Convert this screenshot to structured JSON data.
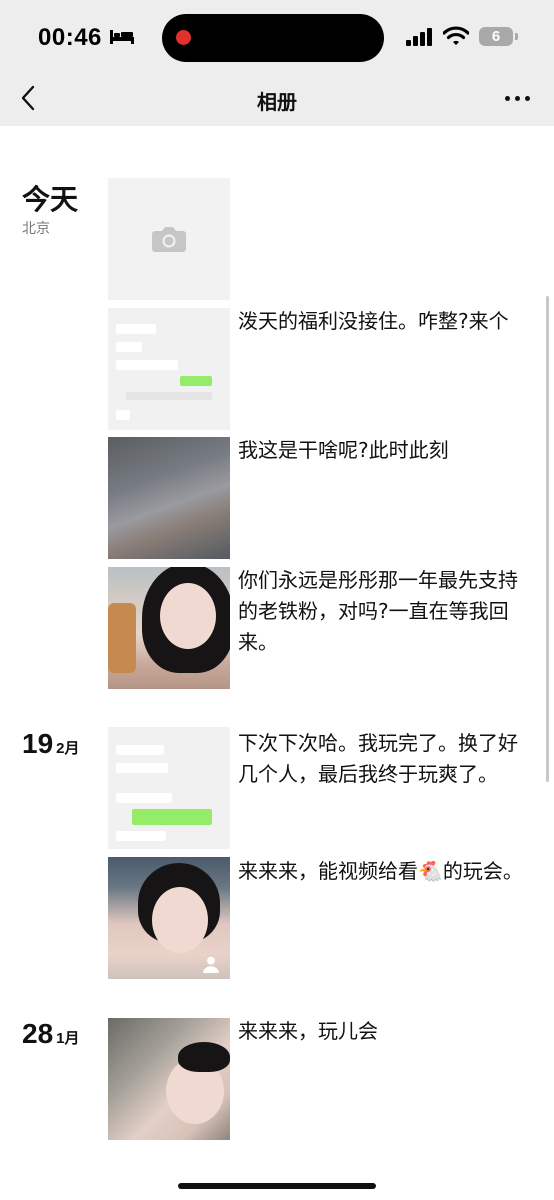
{
  "status_bar": {
    "time": "00:46",
    "battery": "6",
    "icons": [
      "bed-icon",
      "signal-icon",
      "wifi-icon",
      "battery-icon"
    ]
  },
  "nav": {
    "title": "相册",
    "back_icon": "chevron-left-icon",
    "more_icon": "more-dots-icon"
  },
  "groups": [
    {
      "date_big": "今天",
      "date_small": "",
      "location": "北京",
      "posts": [
        {
          "caption": ""
        },
        {
          "caption": "泼天的福利没接住。咋整?来个"
        },
        {
          "caption": "我这是干啥呢?此时此刻"
        },
        {
          "caption": "你们永远是彤彤那一年最先支持的老铁粉，对吗?一直在等我回来。"
        }
      ]
    },
    {
      "date_big": "19",
      "date_small": "2月",
      "location": "",
      "posts": [
        {
          "caption": "下次下次哈。我玩完了。换了好几个人，最后我终于玩爽了。"
        },
        {
          "caption": "来来来，能视频给看🐔的玩会。"
        }
      ]
    },
    {
      "date_big": "28",
      "date_small": "1月",
      "location": "",
      "posts": [
        {
          "caption": "来来来，玩儿会"
        }
      ]
    }
  ],
  "colors": {
    "header_bg": "#ededed",
    "chat_green": "#95ec69",
    "record_dot": "#e0322c"
  }
}
